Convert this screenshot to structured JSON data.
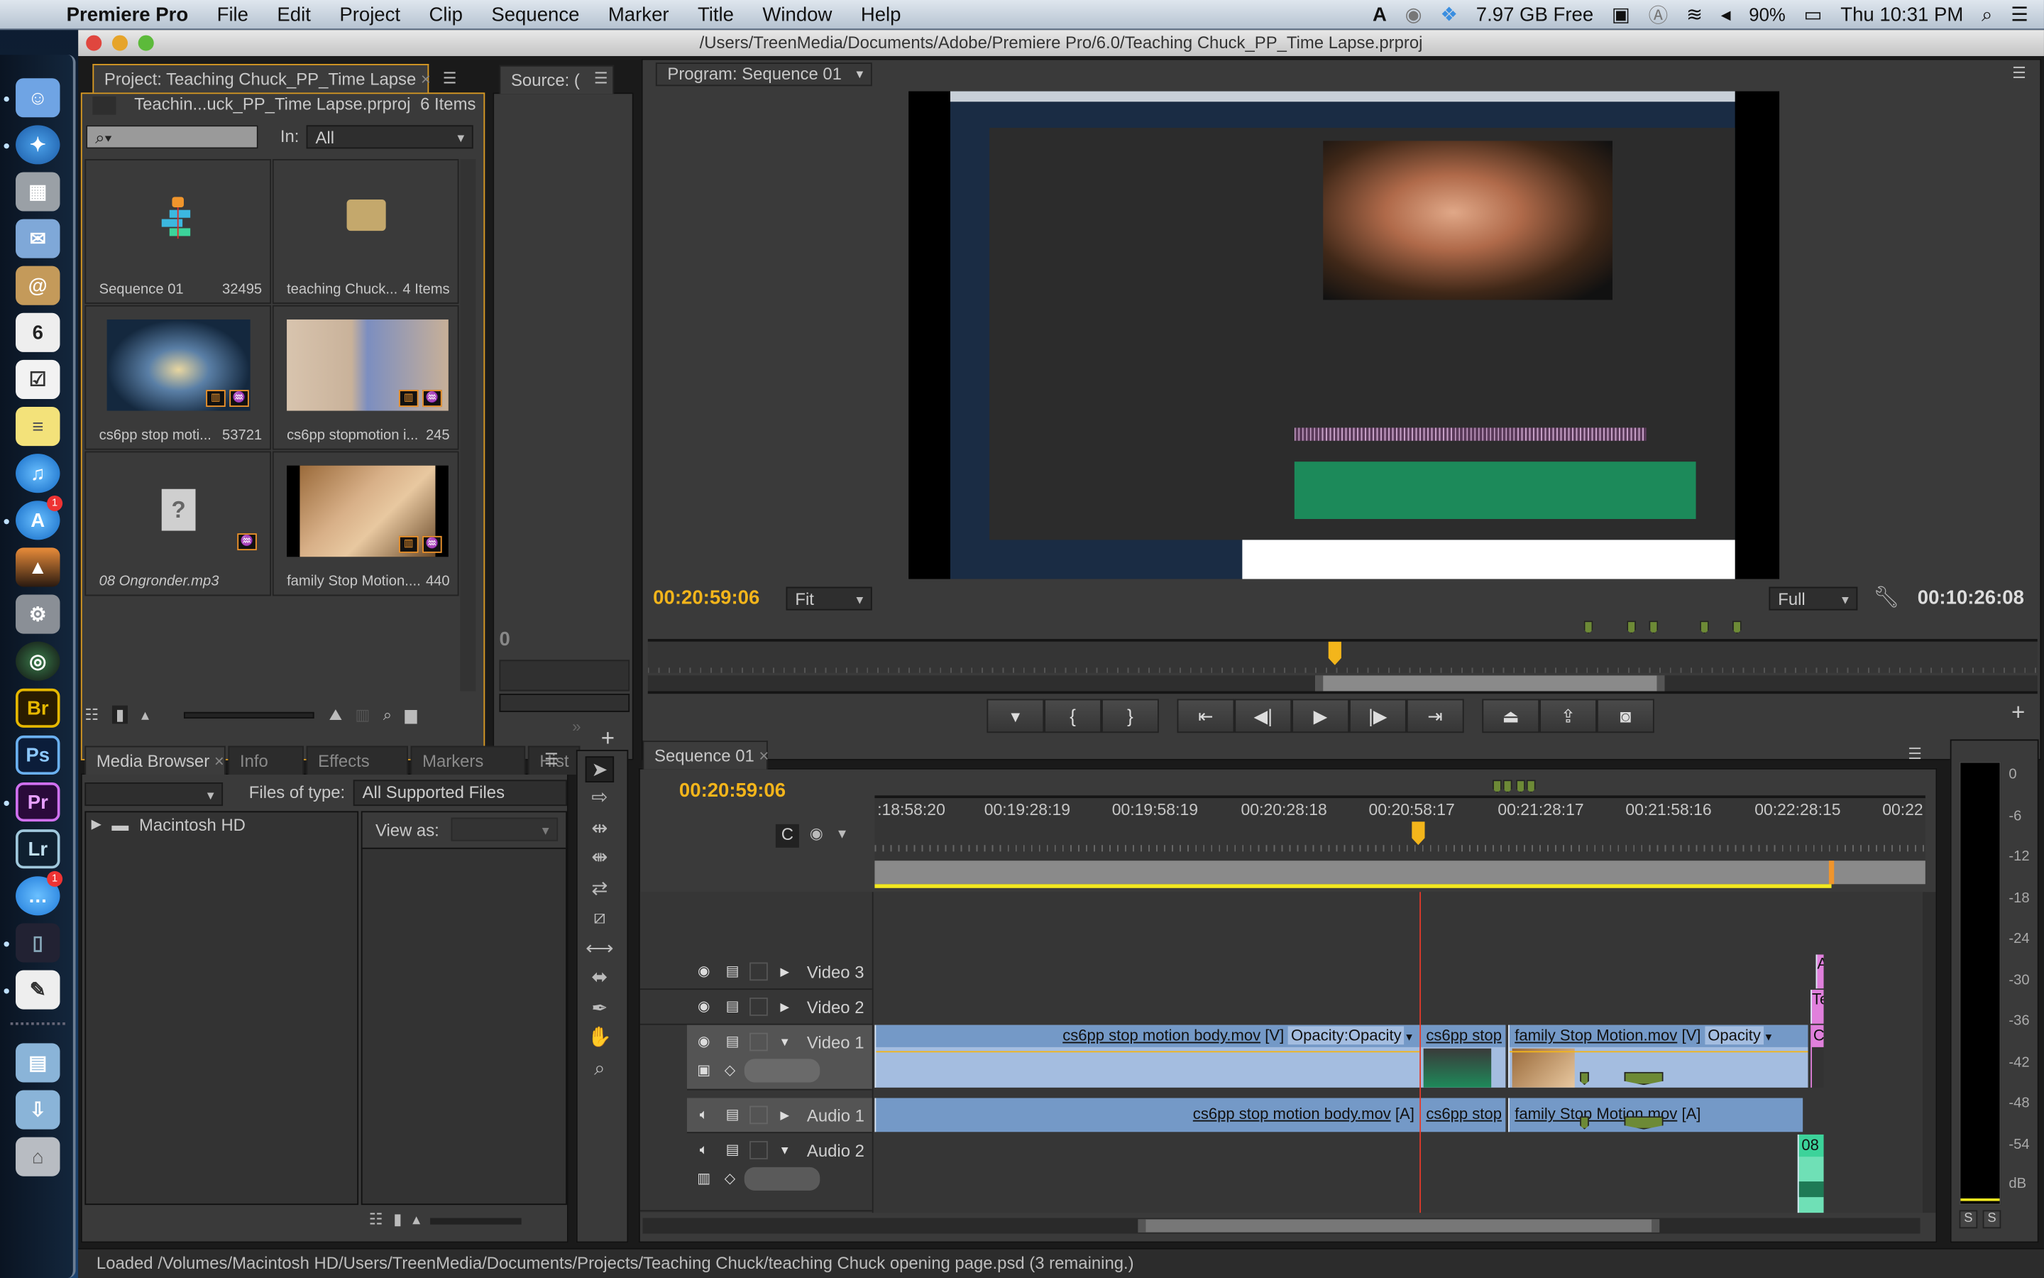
{
  "menubar": {
    "app_name": "Premiere Pro",
    "items": [
      "File",
      "Edit",
      "Project",
      "Clip",
      "Sequence",
      "Marker",
      "Title",
      "Window",
      "Help"
    ],
    "status": {
      "disk_free": "7.97 GB Free",
      "battery": "90%",
      "clock": "Thu 10:31 PM"
    }
  },
  "dock": {
    "items": [
      "Finder",
      "Safari",
      "Calculator",
      "Mail",
      "Contacts",
      "Calendar",
      "Reminders",
      "Stickies",
      "iTunes",
      "App Store",
      "iPhoto",
      "System Preferences",
      "Aperture",
      "Br",
      "Ps",
      "Pr",
      "Lr",
      "Messages",
      "Preview",
      "TextEdit",
      "Documents",
      "Downloads",
      "Trash"
    ],
    "calendar_day": "6",
    "appstore_badge": "1",
    "messages_badge": "1"
  },
  "window": {
    "title": "/Users/TreenMedia/Documents/Adobe/Premiere Pro/6.0/Teaching Chuck_PP_Time Lapse.prproj"
  },
  "project_panel": {
    "tab": "Project: Teaching Chuck_PP_Time Lapse",
    "file": "Teachin...uck_PP_Time Lapse.prproj",
    "count": "6 Items",
    "search_placeholder": "",
    "in_label": "In:",
    "in_value": "All",
    "items": [
      {
        "name": "Sequence 01",
        "meta": "32495",
        "kind": "sequence"
      },
      {
        "name": "teaching Chuck...",
        "meta": "4 Items",
        "kind": "bin"
      },
      {
        "name": "cs6pp stop moti...",
        "meta": "53721",
        "kind": "video"
      },
      {
        "name": "cs6pp stopmotion i...",
        "meta": "245",
        "kind": "video"
      },
      {
        "name": "08 Ongronder.mp3",
        "meta": "",
        "kind": "audio-offline"
      },
      {
        "name": "family Stop Motion....",
        "meta": "440",
        "kind": "video"
      }
    ]
  },
  "source_panel": {
    "tab": "Source: (",
    "timecode": "0"
  },
  "program_panel": {
    "tab": "Program: Sequence 01",
    "current_tc": "00:20:59:06",
    "fit": "Fit",
    "quality": "Full",
    "duration_tc": "00:10:26:08",
    "transport": [
      "Add Marker",
      "Mark In",
      "Mark Out",
      "Go to In",
      "Step Back",
      "Play",
      "Step Forward",
      "Go to Out",
      "Lift",
      "Extract",
      "Export Frame"
    ]
  },
  "media_browser": {
    "tabs": [
      "Media Browser",
      "Info",
      "Effects",
      "Markers",
      "Hist"
    ],
    "files_of_type_label": "Files of type:",
    "files_of_type": "All Supported Files",
    "view_as_label": "View as:",
    "tree": [
      "Macintosh HD"
    ]
  },
  "tools": [
    "Selection",
    "Track Select",
    "Ripple Edit",
    "Rolling Edit",
    "Rate Stretch",
    "Razor",
    "Slip",
    "Slide",
    "Pen",
    "Hand",
    "Zoom"
  ],
  "timeline": {
    "tab": "Sequence 01",
    "current_tc": "00:20:59:06",
    "ruler": [
      ":18:58:20",
      "00:19:28:19",
      "00:19:58:19",
      "00:20:28:18",
      "00:20:58:17",
      "00:21:28:17",
      "00:21:58:16",
      "00:22:28:15",
      "00:22"
    ],
    "tracks": [
      {
        "name": "Video 3",
        "type": "video",
        "expanded": false
      },
      {
        "name": "Video 2",
        "type": "video",
        "expanded": false
      },
      {
        "name": "Video 1",
        "type": "video",
        "expanded": true
      },
      {
        "name": "Audio 1",
        "type": "audio",
        "expanded": false
      },
      {
        "name": "Audio 2",
        "type": "audio",
        "expanded": true
      }
    ],
    "clips": {
      "v1_a": {
        "name": "cs6pp stop motion body.mov",
        "suffix": "[V]",
        "fx": "Opacity:Opacity"
      },
      "v1_b": {
        "name": "cs6pp stop",
        "suffix": ""
      },
      "v1_c": {
        "name": "family Stop Motion.mov",
        "suffix": "[V]",
        "fx": "Opacity"
      },
      "v1_d": {
        "name": "C"
      },
      "v2_a": {
        "name": "Te"
      },
      "v3_a": {
        "name": "A"
      },
      "a1_a": {
        "name": "cs6pp stop motion body.mov",
        "suffix": "[A]"
      },
      "a1_b": {
        "name": "cs6pp stop"
      },
      "a1_c": {
        "name": "family Stop Motion.mov",
        "suffix": "[A]"
      },
      "a2_a": {
        "name": "08"
      }
    }
  },
  "audio_meter": {
    "scale": [
      "0",
      "-6",
      "-12",
      "-18",
      "-24",
      "-30",
      "-36",
      "-42",
      "-48",
      "-54",
      "dB"
    ],
    "solo": [
      "S",
      "S"
    ]
  },
  "status_bar": {
    "text": "Loaded /Volumes/Macintosh HD/Users/TreenMedia/Documents/Projects/Teaching Chuck/teaching Chuck opening page.psd (3 remaining.)"
  },
  "colors": {
    "timecode": "#f3b51b",
    "panel_focus": "#d99a22",
    "clip_video": "#a4bde0",
    "clip_header": "#7499c7",
    "title_clip": "#e080dc",
    "audio_clip": "#6fe0b6",
    "playhead": "#e03a2a",
    "marker": "#6d8a36"
  }
}
